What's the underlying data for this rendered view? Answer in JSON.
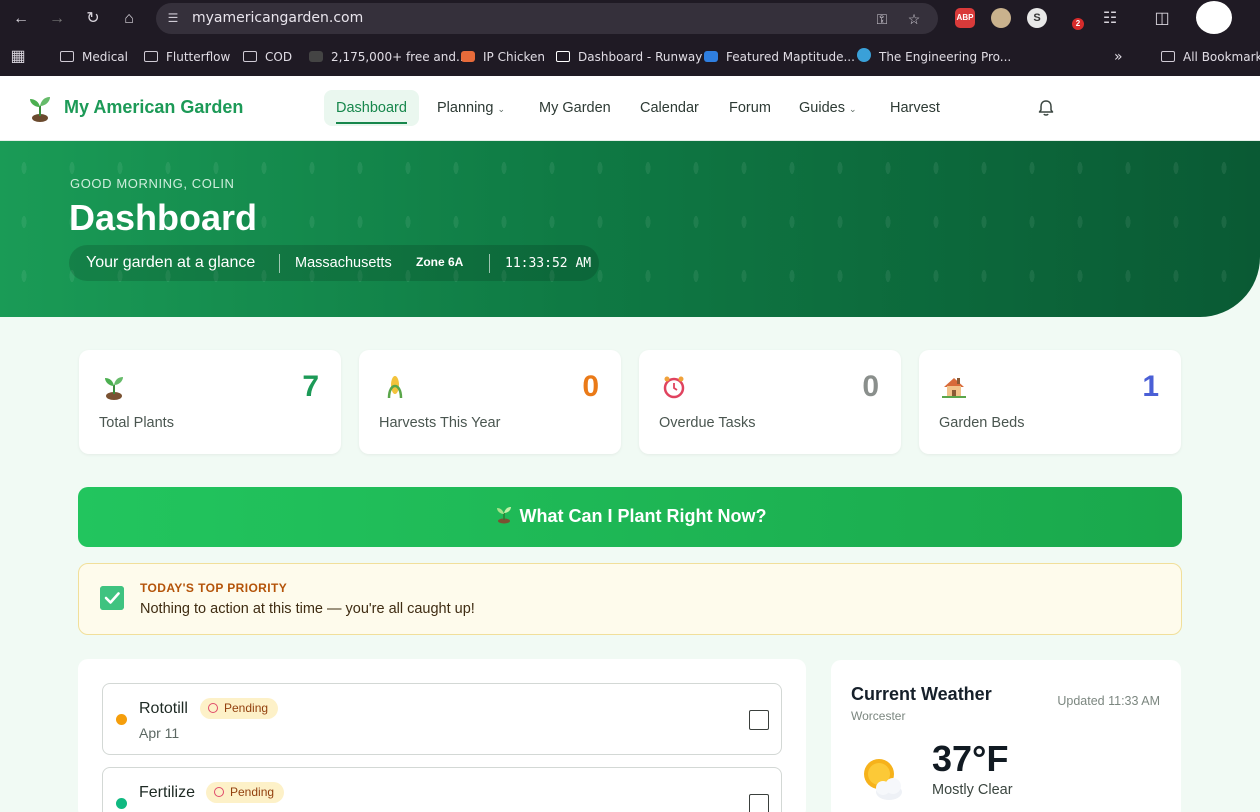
{
  "browser": {
    "url": "myamericangarden.com",
    "ext_abp": "ABP",
    "ext_badge": "2",
    "bookmarks": [
      "Medical",
      "Flutterflow",
      "COD",
      "2,175,000+ free and...",
      "IP Chicken",
      "Dashboard - Runway",
      "Featured Maptitude...",
      "The Engineering Pro..."
    ],
    "all_bookmarks": "All Bookmarks"
  },
  "header": {
    "brand": "My American Garden",
    "nav": [
      "Dashboard",
      "Planning",
      "My Garden",
      "Calendar",
      "Forum",
      "Guides",
      "Harvest"
    ]
  },
  "hero": {
    "greeting": "GOOD MORNING, COLIN",
    "title": "Dashboard",
    "subtitle": "Your garden at a glance",
    "state": "Massachusetts",
    "zone": "Zone 6A",
    "time": "11:33:52 AM"
  },
  "stats": [
    {
      "value": "7",
      "label": "Total Plants",
      "color": "#1c9a57",
      "icon": "sprout-icon"
    },
    {
      "value": "0",
      "label": "Harvests This Year",
      "color": "#ea7a18",
      "icon": "corn-icon"
    },
    {
      "value": "0",
      "label": "Overdue Tasks",
      "color": "#8a8f8c",
      "icon": "alarm-clock-icon"
    },
    {
      "value": "1",
      "label": "Garden Beds",
      "color": "#4a5fd6",
      "icon": "house-icon"
    }
  ],
  "plant_now": {
    "label": "What Can I Plant Right Now?"
  },
  "priority": {
    "label": "TODAY'S TOP PRIORITY",
    "text": "Nothing to action at this time — you're all caught up!"
  },
  "tasks": [
    {
      "name": "Rototill",
      "status": "Pending",
      "date": "Apr 11",
      "dot_color": "#f59e0b"
    },
    {
      "name": "Fertilize",
      "status": "Pending",
      "date": "",
      "dot_color": "#10b981"
    }
  ],
  "weather": {
    "title": "Current Weather",
    "location": "Worcester",
    "updated": "Updated 11:33 AM",
    "temp": "37°F",
    "condition": "Mostly Clear"
  }
}
